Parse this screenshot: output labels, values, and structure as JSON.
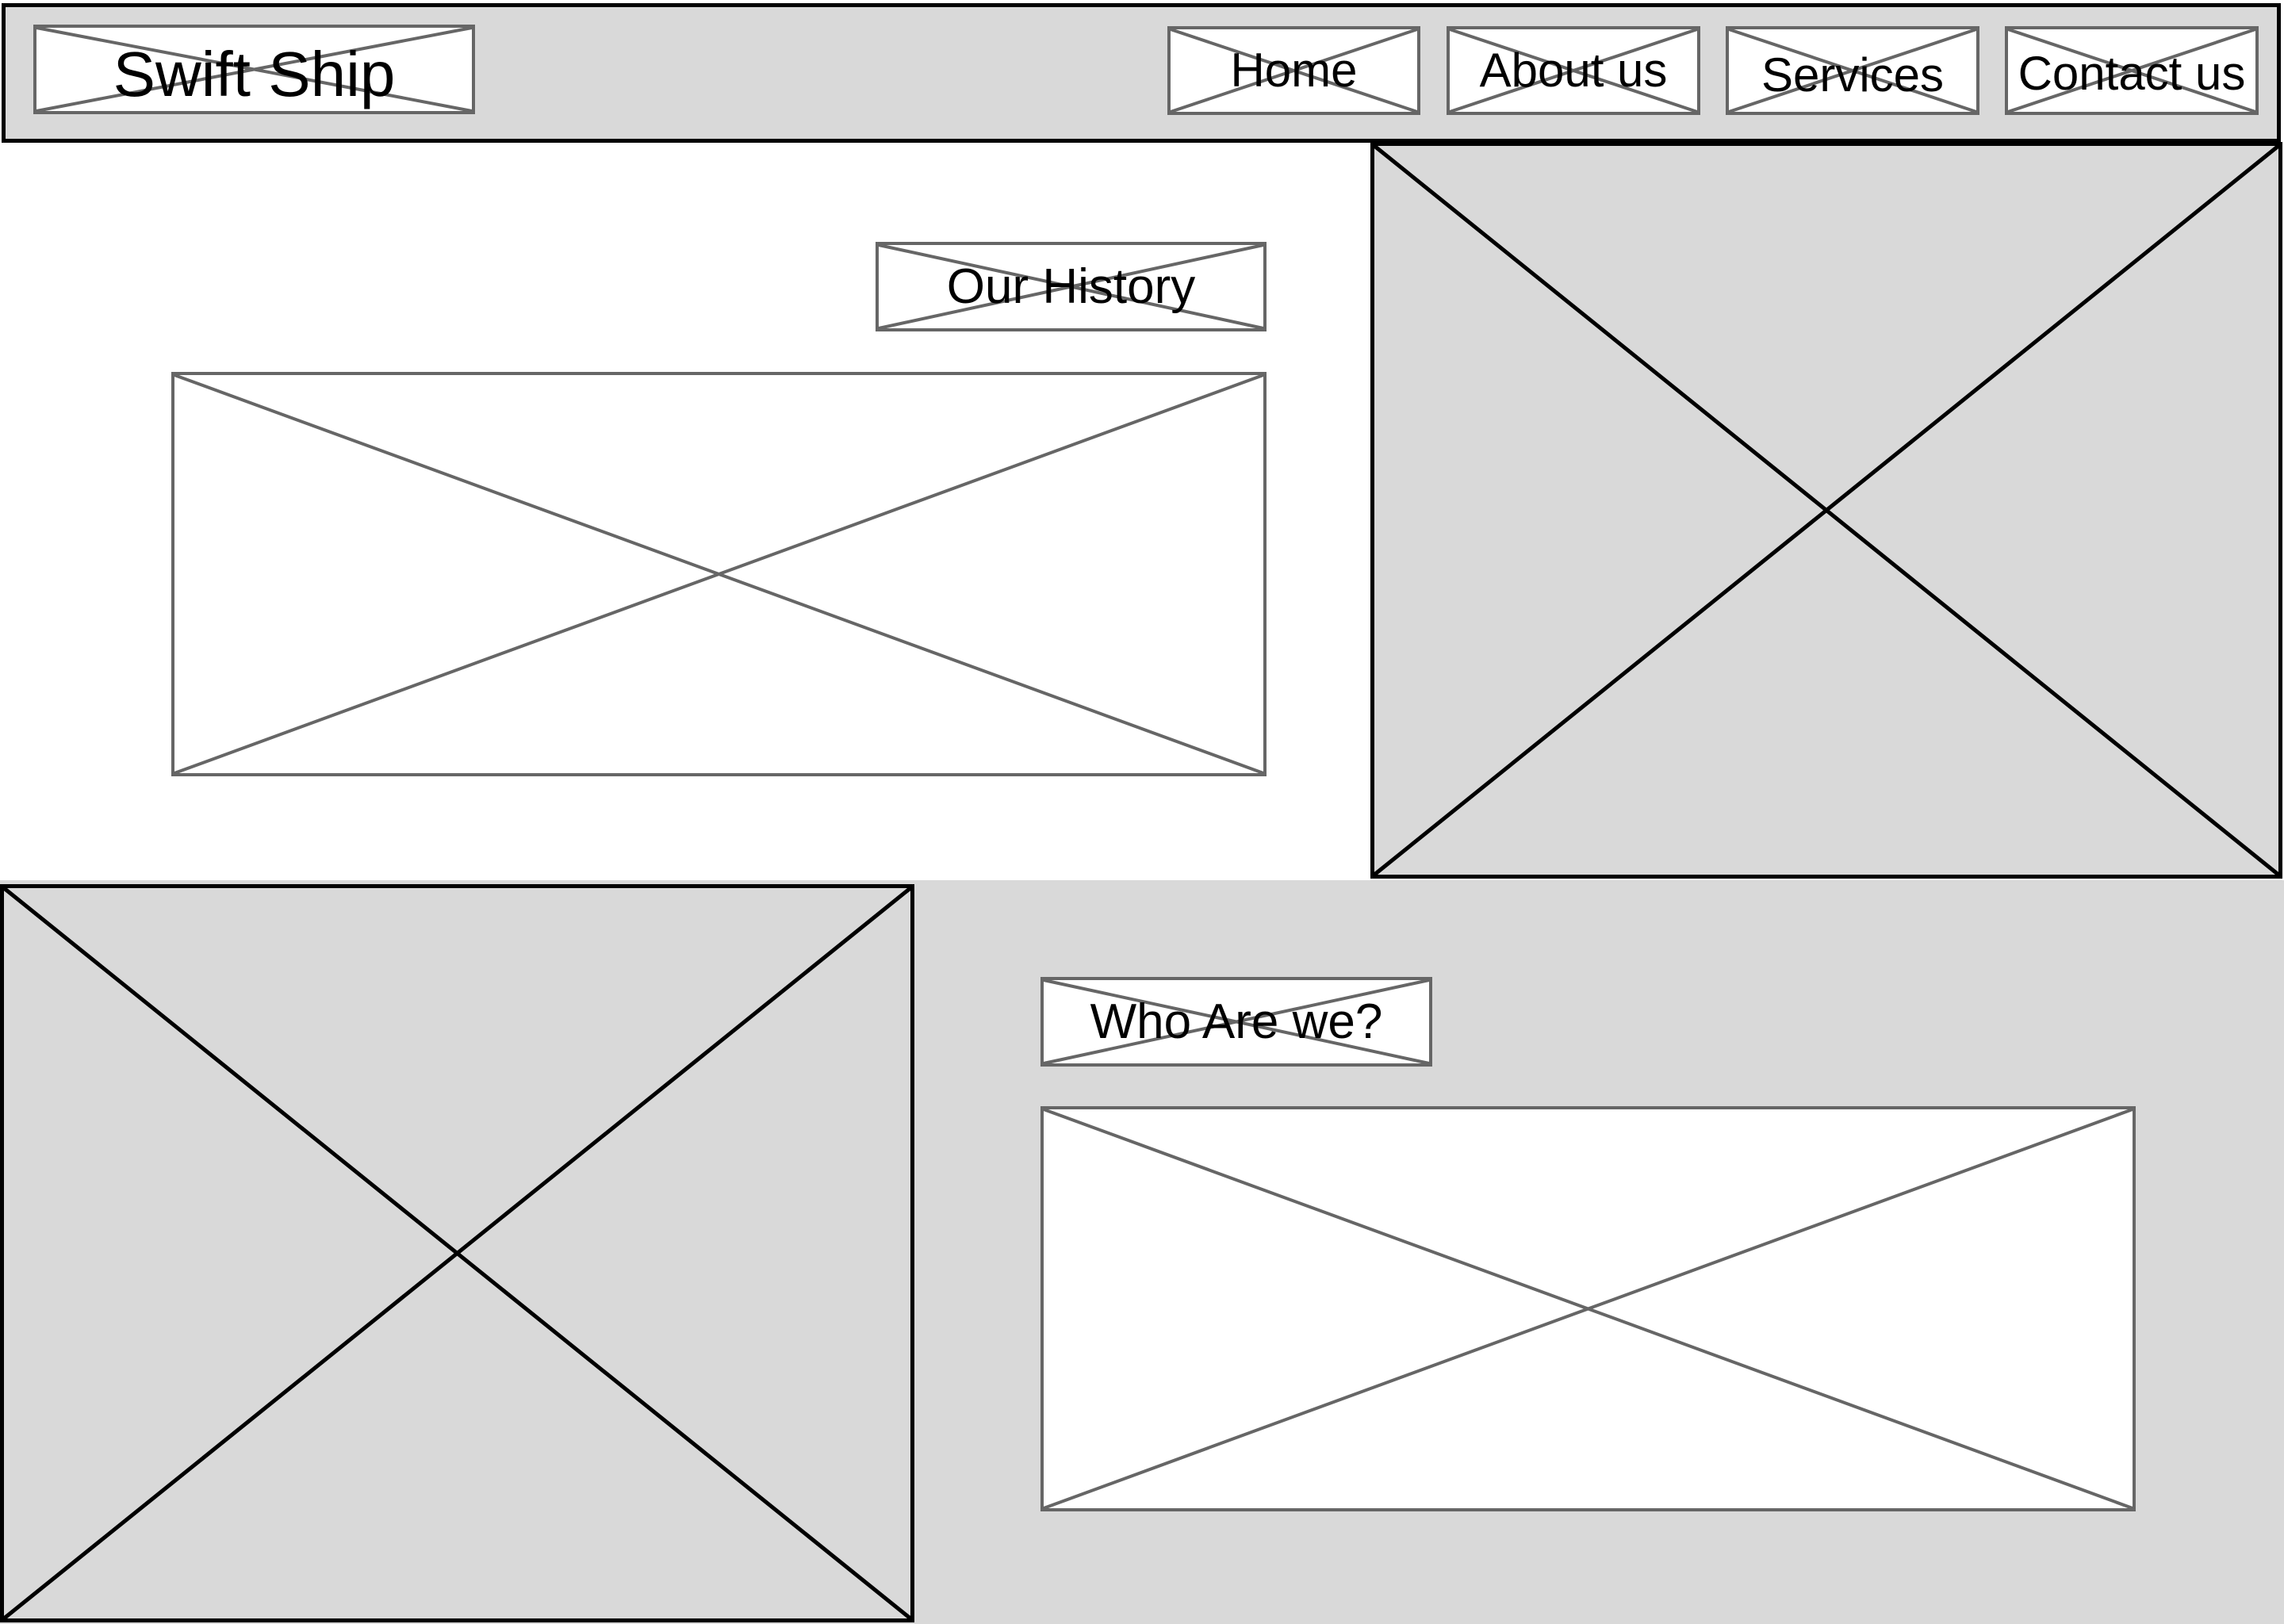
{
  "header": {
    "logo": "Swift Ship",
    "nav": [
      {
        "label": "Home"
      },
      {
        "label": "About us"
      },
      {
        "label": "Services"
      },
      {
        "label": "Contact us"
      }
    ]
  },
  "history_section": {
    "heading": "Our History"
  },
  "about_section": {
    "heading": "Who Are we?"
  },
  "colors": {
    "panel_gray": "#d9d9d9",
    "outline_dark": "#000000",
    "outline_gray": "#666666",
    "placeholder_white": "#ffffff"
  }
}
